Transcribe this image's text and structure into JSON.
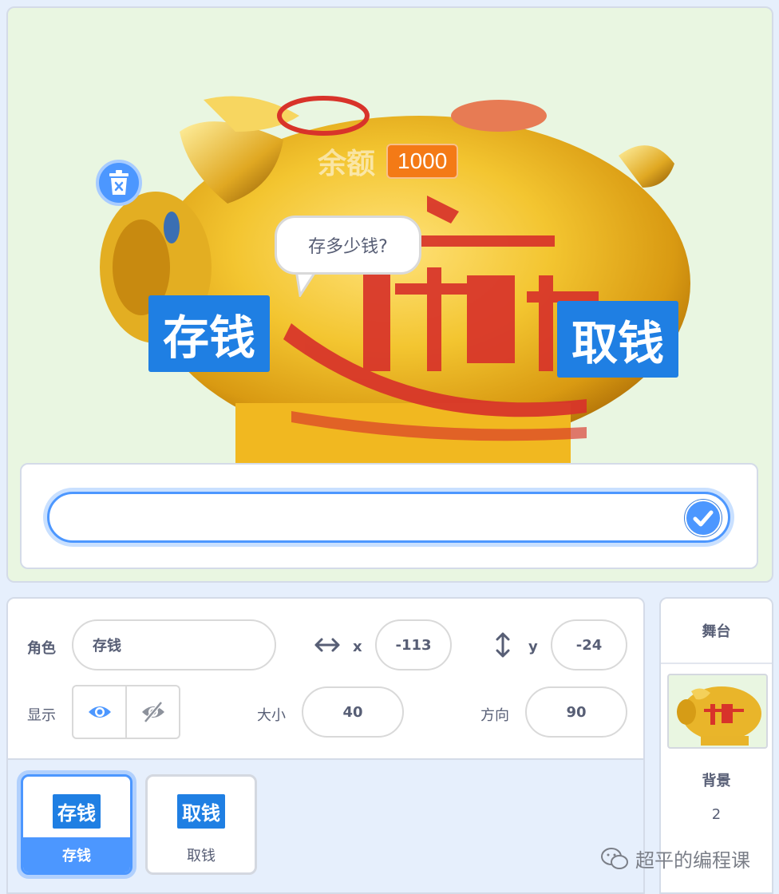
{
  "stage": {
    "variable_monitor": {
      "label": "余额",
      "value": "1000"
    },
    "speech_bubble": "存多少钱?",
    "buttons": {
      "deposit": "存钱",
      "withdraw": "取钱"
    },
    "ask_input": {
      "value": ""
    }
  },
  "sprite_info": {
    "sprite_label": "角色",
    "sprite_name": "存钱",
    "x_label": "x",
    "x_value": "-113",
    "y_label": "y",
    "y_value": "-24",
    "show_label": "显示",
    "size_label": "大小",
    "size_value": "40",
    "direction_label": "方向",
    "direction_value": "90"
  },
  "sprites": [
    {
      "thumb": "存钱",
      "name": "存钱",
      "selected": true
    },
    {
      "thumb": "取钱",
      "name": "取钱",
      "selected": false
    }
  ],
  "stage_panel": {
    "title": "舞台",
    "backdrop_label": "背景",
    "backdrop_count": "2"
  },
  "watermark": "超平的编程课",
  "colors": {
    "accent": "#4c97ff",
    "button_blue": "#1f7fe3",
    "monitor_orange": "#f47a16",
    "stage_bg": "#e9f6e1"
  }
}
